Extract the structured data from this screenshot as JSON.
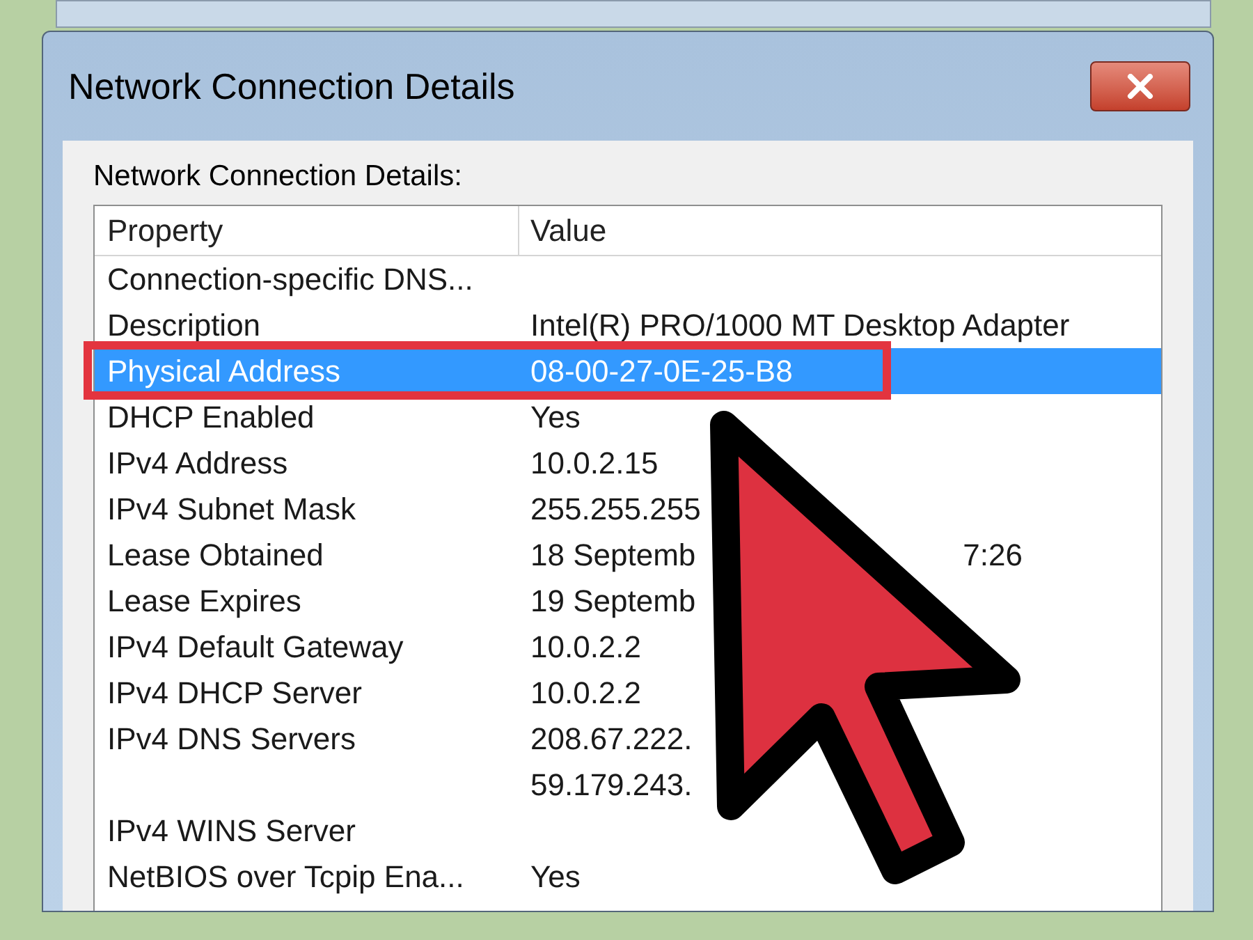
{
  "window": {
    "title": "Network Connection Details"
  },
  "group_label": "Network Connection Details:",
  "table": {
    "columns": [
      "Property",
      "Value"
    ],
    "rows": [
      {
        "property": "Connection-specific DNS...",
        "value": "",
        "selected": false
      },
      {
        "property": "Description",
        "value": "Intel(R) PRO/1000 MT Desktop Adapter",
        "selected": false
      },
      {
        "property": "Physical Address",
        "value": "08-00-27-0E-25-B8",
        "selected": true
      },
      {
        "property": "DHCP Enabled",
        "value": "Yes",
        "selected": false
      },
      {
        "property": "IPv4 Address",
        "value": "10.0.2.15",
        "selected": false
      },
      {
        "property": "IPv4 Subnet Mask",
        "value": "255.255.255",
        "selected": false
      },
      {
        "property": "Lease Obtained",
        "value": "18 Septemb",
        "tail": "7:26",
        "selected": false
      },
      {
        "property": "Lease Expires",
        "value": "19 Septemb",
        "selected": false
      },
      {
        "property": "IPv4 Default Gateway",
        "value": "10.0.2.2",
        "selected": false
      },
      {
        "property": "IPv4 DHCP Server",
        "value": "10.0.2.2",
        "selected": false
      },
      {
        "property": "IPv4 DNS Servers",
        "value": "208.67.222.",
        "selected": false
      },
      {
        "property": "",
        "value": "59.179.243.",
        "selected": false
      },
      {
        "property": "IPv4 WINS Server",
        "value": "",
        "selected": false
      },
      {
        "property": "NetBIOS over Tcpip Ena...",
        "value": "Yes",
        "selected": false
      }
    ]
  }
}
